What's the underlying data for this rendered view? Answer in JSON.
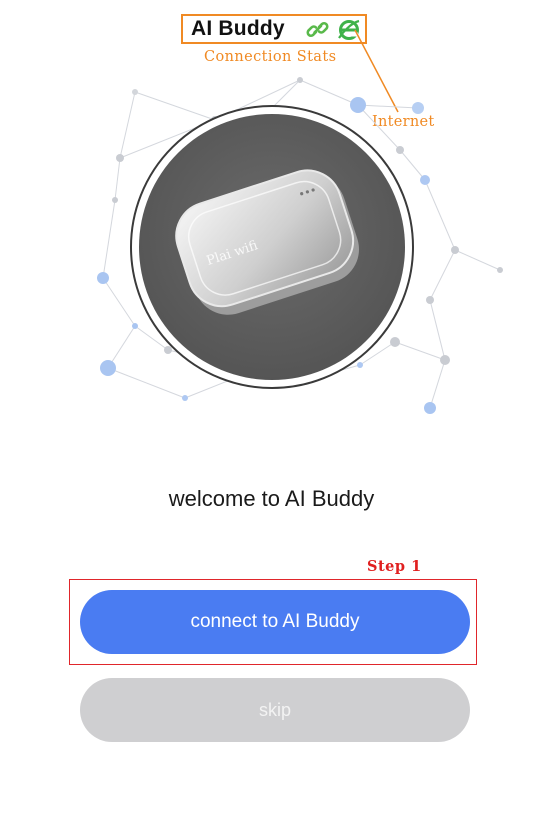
{
  "header": {
    "title": "AI Buddy",
    "link_icon": "link-icon",
    "internet_icon": "internet-explorer-icon"
  },
  "annotations": {
    "connection_stats": "Connection Stats",
    "internet": "Internet",
    "step": "Step 1",
    "color": "#f08a24",
    "step_color": "#e02020"
  },
  "hero": {
    "device_label": "Plai wifi"
  },
  "welcome": {
    "text": "welcome to AI Buddy"
  },
  "buttons": {
    "connect_label": "connect to AI Buddy",
    "skip_label": "skip",
    "connect_color": "#4a7cf2",
    "skip_color": "#cfcfd1"
  }
}
